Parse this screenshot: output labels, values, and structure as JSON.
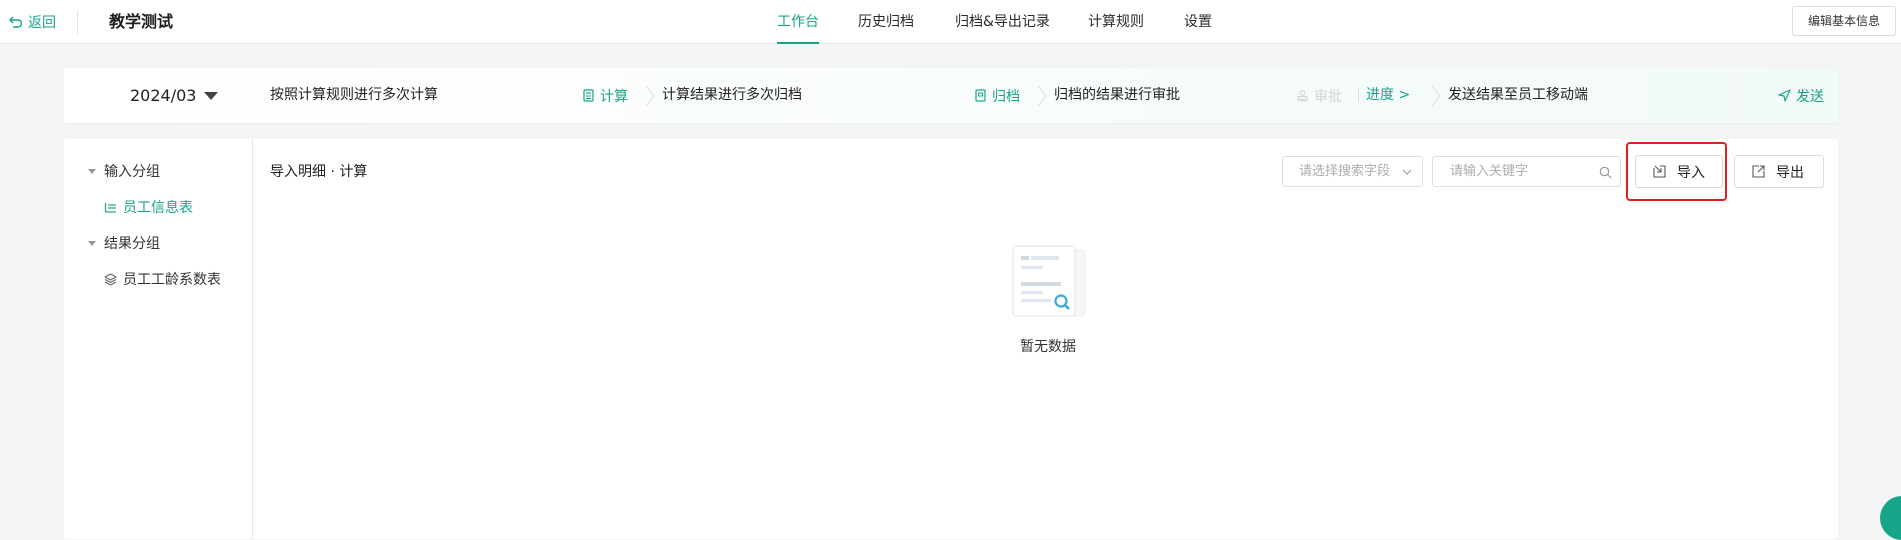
{
  "header": {
    "back_label": "返回",
    "app_title": "教学测试",
    "tabs": [
      {
        "label": "工作台",
        "active": true
      },
      {
        "label": "历史归档",
        "active": false
      },
      {
        "label": "归档&导出记录",
        "active": false
      },
      {
        "label": "计算规则",
        "active": false
      },
      {
        "label": "设置",
        "active": false
      }
    ],
    "edit_button": "编辑基本信息"
  },
  "steps": {
    "period": "2024/03",
    "items": [
      {
        "text": "按照计算规则进行多次计算",
        "action": "计算",
        "action_icon": "calculator-icon"
      },
      {
        "text": "计算结果进行多次归档",
        "action": "归档",
        "action_icon": "archive-icon"
      },
      {
        "text": "归档的结果进行审批",
        "action": "审批",
        "action_icon": "stamp-icon",
        "action_disabled": true,
        "link": "进度 >"
      },
      {
        "text": "发送结果至员工移动端",
        "action": "发送",
        "action_icon": "send-icon"
      }
    ]
  },
  "sidebar": {
    "groups": [
      {
        "label": "输入分组",
        "items": [
          {
            "label": "员工信息表",
            "icon": "list-icon",
            "active": true
          }
        ]
      },
      {
        "label": "结果分组",
        "items": [
          {
            "label": "员工工龄系数表",
            "icon": "layers-icon",
            "active": false
          }
        ]
      }
    ]
  },
  "content": {
    "title": "导入明细 · 计算",
    "search_field_placeholder": "请选择搜索字段",
    "keyword_placeholder": "请输入关键字",
    "import_button": "导入",
    "export_button": "导出",
    "empty_text": "暂无数据"
  },
  "colors": {
    "accent": "#17a589",
    "highlight": "#e0201f"
  }
}
